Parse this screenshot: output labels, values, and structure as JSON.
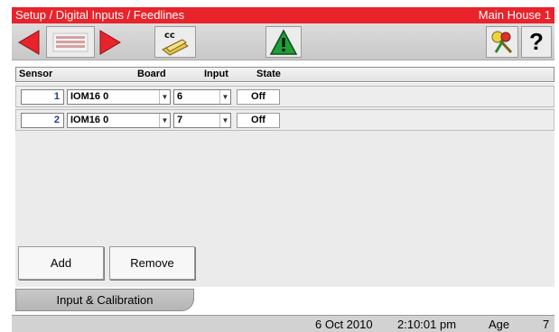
{
  "titlebar": {
    "breadcrumb": "Setup / Digital Inputs / Feedlines",
    "location": "Main House 1"
  },
  "toolbar": {
    "help_label": "?",
    "cc_label": "cc"
  },
  "columns": {
    "sensor": "Sensor",
    "board": "Board",
    "input": "Input",
    "state": "State"
  },
  "rows": [
    {
      "sensor": "1",
      "board": "IOM16 0",
      "input": "6",
      "state": "Off"
    },
    {
      "sensor": "2",
      "board": "IOM16 0",
      "input": "7",
      "state": "Off"
    }
  ],
  "buttons": {
    "add": "Add",
    "remove": "Remove"
  },
  "tab": {
    "label": "Input & Calibration"
  },
  "status": {
    "date": "6 Oct 2010",
    "time": "2:10:01 pm",
    "age_label": "Age",
    "age_value": "7"
  },
  "colors": {
    "title_bar": "#e8232c",
    "nav_arrow": "#e8232c",
    "alarm_triangle": "#1f9e3a",
    "sensor_number": "#203a9a"
  }
}
